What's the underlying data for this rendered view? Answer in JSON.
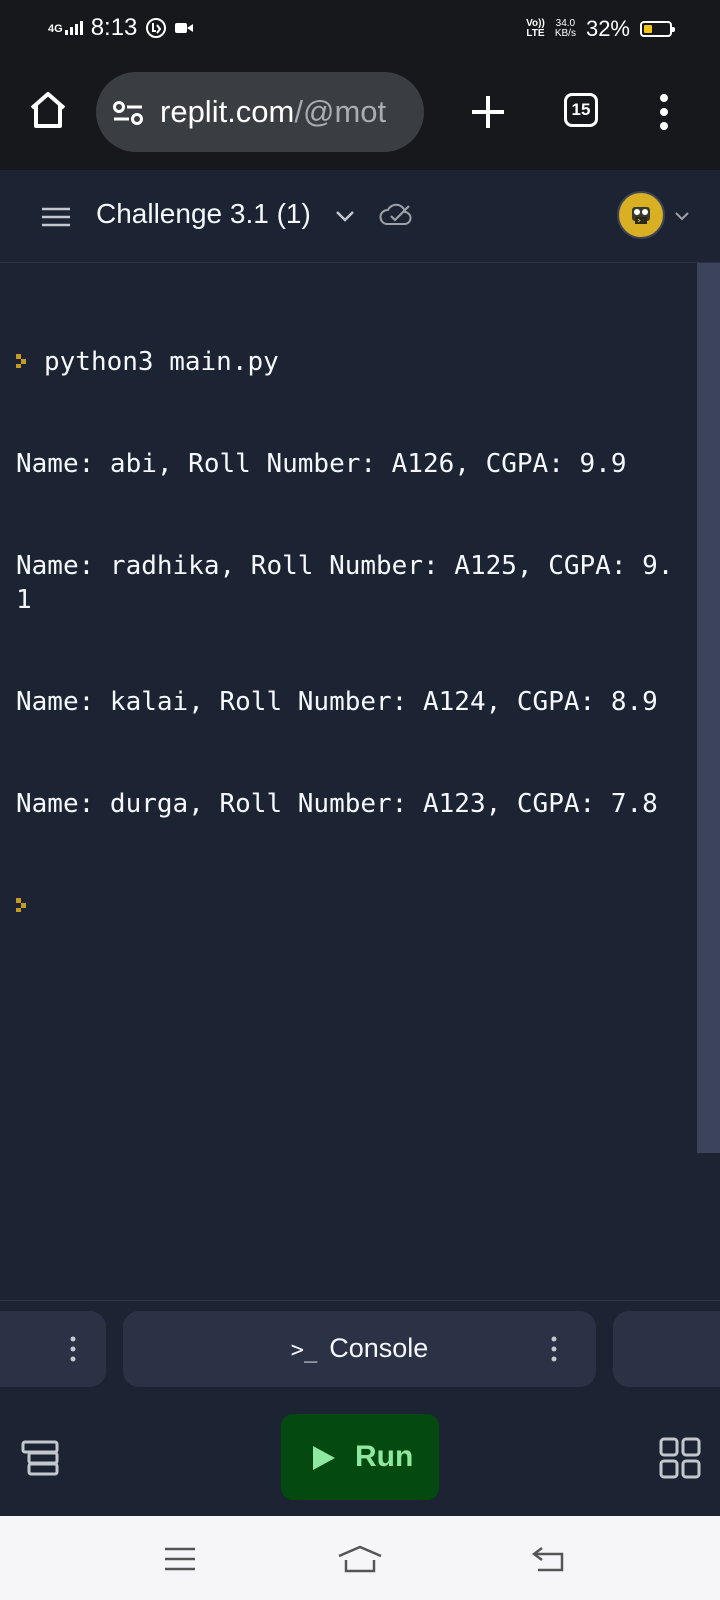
{
  "status_bar": {
    "network": "4G",
    "time": "8:13",
    "volte_top": "Vo))",
    "volte_bottom": "LTE",
    "speed_value": "34.0",
    "speed_unit": "KB/s",
    "battery_percent": "32%",
    "battery_level": 0.32,
    "battery_color": "#f5c518"
  },
  "browser": {
    "url_main": "replit.com",
    "url_path": "/@mot",
    "tab_count": "15",
    "icons": [
      "home-icon",
      "site-settings-icon",
      "plus-icon",
      "tabs-counter",
      "more-vert-icon"
    ]
  },
  "repl_header": {
    "title": "Challenge 3.1 (1)",
    "icons": [
      "menu-icon",
      "chevron-down-icon",
      "cloud-check-icon",
      "avatar",
      "chevron-down-icon"
    ]
  },
  "console": {
    "command": "python3 main.py",
    "lines": [
      "Name: abi, Roll Number: A126, CGPA: 9.9",
      "Name: radhika, Roll Number: A125, CGPA: 9.1",
      "Name: kalai, Roll Number: A124, CGPA: 8.9",
      "Name: durga, Roll Number: A123, CGPA: 7.8"
    ],
    "prompt_color": "#c59b25"
  },
  "bottom_tabs": {
    "console_icon": ">_",
    "console_label": "Console"
  },
  "action_bar": {
    "run_label": "Run",
    "run_color": "#8fe89f"
  },
  "colors": {
    "background": "#1c2333",
    "surface": "#2b3245",
    "browser_chrome": "#16181c"
  }
}
